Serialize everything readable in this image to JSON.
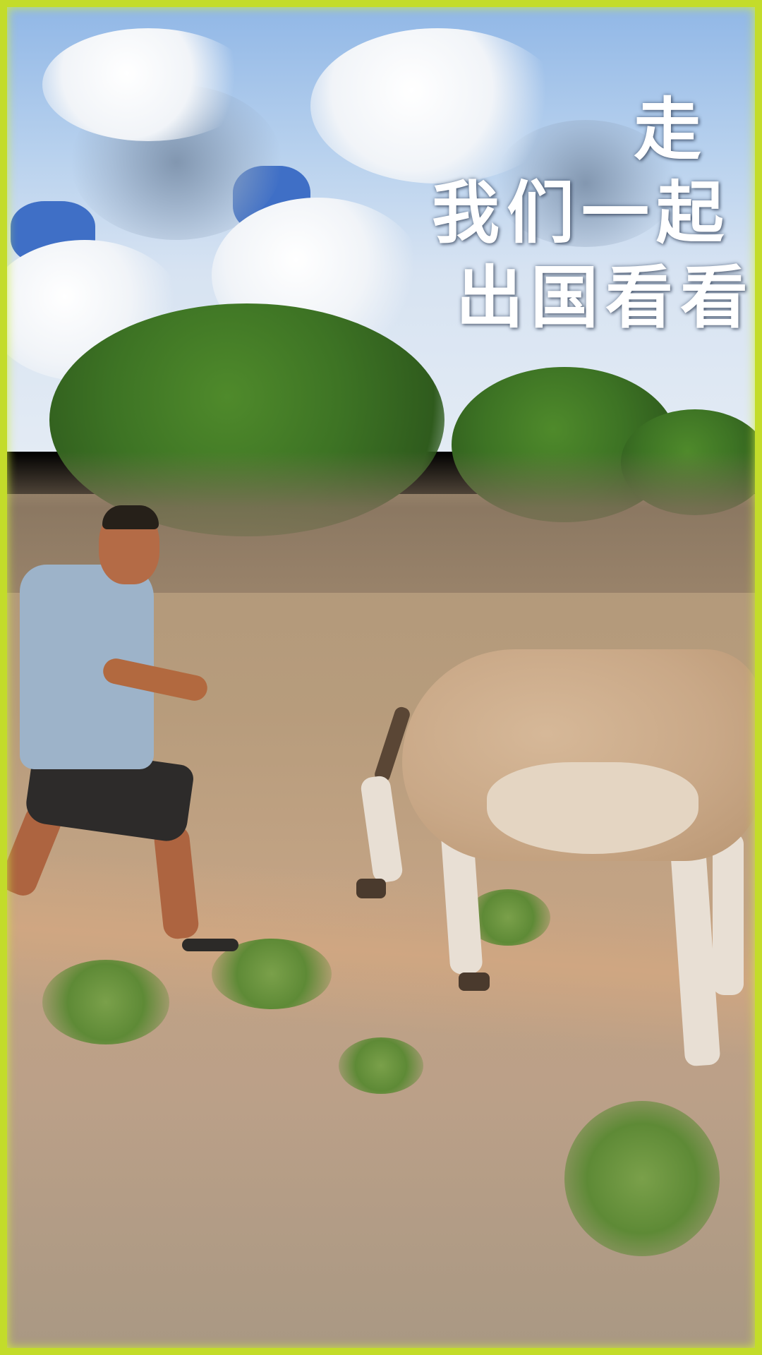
{
  "overlay_text": {
    "line1": "走",
    "line2": "我们一起",
    "line3": "出国看看"
  },
  "colors": {
    "border": "#c3dc2a",
    "text": "#ffffff",
    "sky": "#b9d2ee",
    "ground": "#b79c7c",
    "foliage": "#3d7324"
  }
}
